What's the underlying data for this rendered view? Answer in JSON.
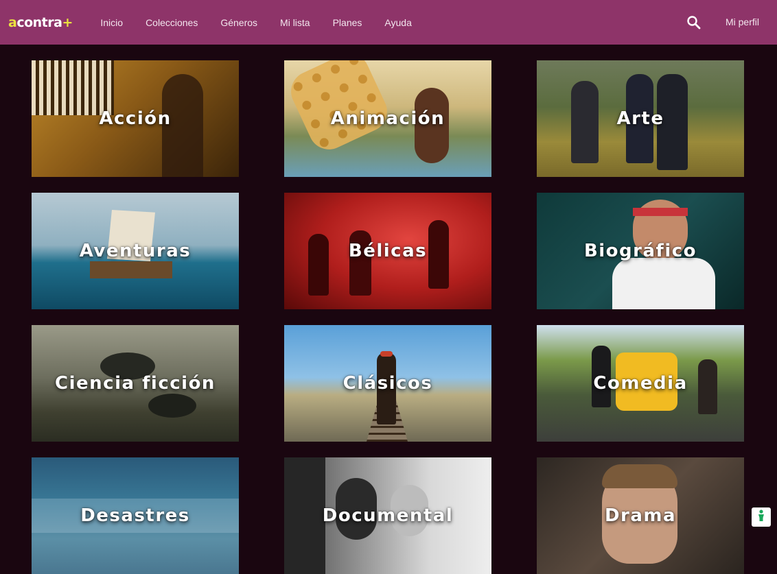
{
  "app": {
    "logo_a": "a",
    "logo_rest": "contra",
    "logo_plus": "+",
    "accent": "#8e3469",
    "background": "#1a0610"
  },
  "nav": {
    "items": [
      "Inicio",
      "Colecciones",
      "Géneros",
      "Mi lista",
      "Planes",
      "Ayuda"
    ],
    "profile": "Mi perfil",
    "search_icon": "search-icon"
  },
  "genres": [
    {
      "label": "Acción"
    },
    {
      "label": "Animación"
    },
    {
      "label": "Arte"
    },
    {
      "label": "Aventuras"
    },
    {
      "label": "Bélicas"
    },
    {
      "label": "Biográfico"
    },
    {
      "label": "Ciencia ficción"
    },
    {
      "label": "Clásicos"
    },
    {
      "label": "Comedia"
    },
    {
      "label": "Desastres"
    },
    {
      "label": "Documental"
    },
    {
      "label": "Drama"
    }
  ],
  "helper": {
    "icon": "accessibility-icon",
    "color": "#1aa85b"
  }
}
